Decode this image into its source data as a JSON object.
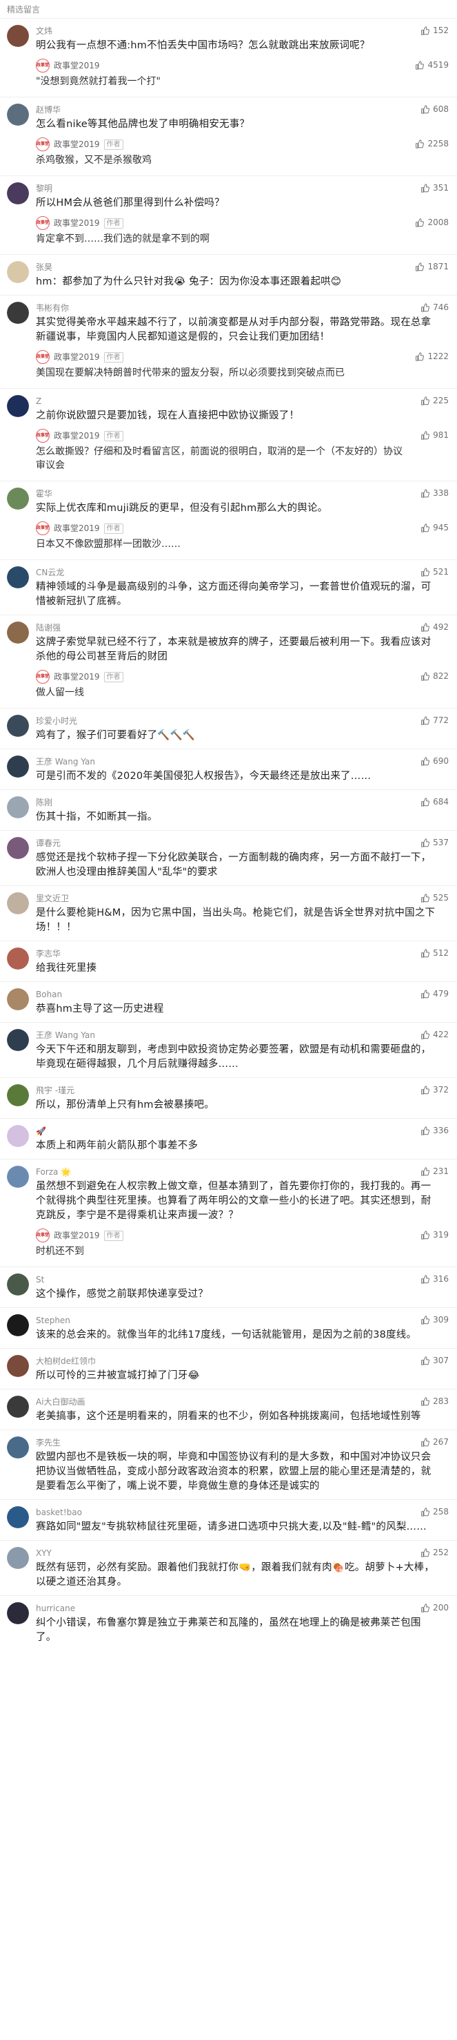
{
  "section_title": "精选留言",
  "colors": {
    "accent": "#e06060",
    "text": "#222222",
    "muted": "#8a8a8a"
  },
  "comments": [
    {
      "nick": "文炜",
      "likes": "152",
      "avatar_color": "#7a4a3a",
      "text": "明公我有一点想不通:hm不怕丢失中国市场吗？怎么就敢跳出来放厥词呢？",
      "reply": {
        "author": "政事堂2019",
        "badge": "",
        "likes": "4519",
        "text": "\"没想到竟然就打着我一个打\""
      }
    },
    {
      "nick": "赵博华",
      "likes": "608",
      "avatar_color": "#5c6e7e",
      "text": "怎么看nike等其他品牌也发了申明确相安无事？",
      "reply": {
        "author": "政事堂2019",
        "badge": "作者",
        "likes": "2258",
        "text": "杀鸡敬猴，又不是杀猴敬鸡"
      }
    },
    {
      "nick": "黎明",
      "likes": "351",
      "avatar_color": "#4a3a5e",
      "text": "所以HM会从爸爸们那里得到什么补偿吗？",
      "reply": {
        "author": "政事堂2019",
        "badge": "作者",
        "likes": "2008",
        "text": "肯定拿不到……我们选的就是拿不到的啊"
      }
    },
    {
      "nick": "张昊",
      "likes": "1871",
      "avatar_color": "#d8c8a8",
      "text": "hm：都参加了为什么只针对我😭 兔子：因为你没本事还跟着起哄😊",
      "reply": null
    },
    {
      "nick": "韦彬有你",
      "likes": "746",
      "avatar_color": "#3a3a3a",
      "text": "其实觉得美帝水平越来越不行了，以前演变都是从对手内部分裂，带路党带路。现在总拿新疆说事，毕竟国内人民都知道这是假的，只会让我们更加团结！",
      "reply": {
        "author": "政事堂2019",
        "badge": "作者",
        "likes": "1222",
        "text": "美国现在要解决特朗普时代带来的盟友分裂，所以必须要找到突破点而已"
      }
    },
    {
      "nick": "Z",
      "likes": "225",
      "avatar_color": "#1e2e5a",
      "text": "之前你说欧盟只是要加钱，现在人直接把中欧协议撕毁了！",
      "reply": {
        "author": "政事堂2019",
        "badge": "作者",
        "likes": "981",
        "text": "怎么敢撕毁？仔细和及时看留言区，前面说的很明白，取消的是一个（不友好的）协议审议会"
      }
    },
    {
      "nick": "霍华",
      "likes": "338",
      "avatar_color": "#6a8a5a",
      "text": "实际上优衣库和muji跳反的更早，但没有引起hm那么大的舆论。",
      "reply": {
        "author": "政事堂2019",
        "badge": "作者",
        "likes": "945",
        "text": "日本又不像欧盟那样一团散沙……"
      }
    },
    {
      "nick": "CN云龙",
      "likes": "521",
      "avatar_color": "#2a4a6a",
      "text": "精神领域的斗争是最高级别的斗争，这方面还得向美帝学习，一套普世价值观玩的溜，可惜被新冠扒了底裤。",
      "reply": null
    },
    {
      "nick": "陆谢强",
      "likes": "492",
      "avatar_color": "#8a6a4a",
      "text": "这牌子索觉早就已经不行了，本来就是被放弃的牌子，还要最后被利用一下。我看应该对杀他的母公司甚至背后的财团",
      "reply": {
        "author": "政事堂2019",
        "badge": "作者",
        "likes": "822",
        "text": "做人留一线"
      }
    },
    {
      "nick": "珍爱小时光",
      "likes": "772",
      "avatar_color": "#3a4a5a",
      "text": "鸡有了，猴子们可要看好了🔨🔨🔨",
      "reply": null
    },
    {
      "nick": "王彦 Wang Yan",
      "likes": "690",
      "avatar_color": "#2e3e4e",
      "text": "可是引而不发的《2020年美国侵犯人权报告》，今天最终还是放出来了……",
      "reply": null
    },
    {
      "nick": "陈刚",
      "likes": "684",
      "avatar_color": "#9aa6b2",
      "text": "伤其十指，不如断其一指。",
      "reply": null
    },
    {
      "nick": "谭春元",
      "likes": "537",
      "avatar_color": "#7a5a7a",
      "text": "感觉还是找个软柿子捏一下分化欧美联合，一方面制裁的确肉疼，另一方面不敲打一下，欧洲人也没理由推辞美国人\"乱华\"的要求",
      "reply": null
    },
    {
      "nick": "里文近卫",
      "likes": "525",
      "avatar_color": "#c0b0a0",
      "text": "是什么要枪毙H&M，因为它黑中国，当出头鸟。枪毙它们，就是告诉全世界对抗中国之下场！！！",
      "reply": null
    },
    {
      "nick": "李志华",
      "likes": "512",
      "avatar_color": "#b06050",
      "text": "给我往死里揍",
      "reply": null
    },
    {
      "nick": "Bohan",
      "likes": "479",
      "avatar_color": "#a88866",
      "text": "恭喜hm主导了这一历史进程",
      "reply": null
    },
    {
      "nick": "王彦 Wang Yan",
      "likes": "422",
      "avatar_color": "#2e3e4e",
      "text": "今天下午还和朋友聊到，考虑到中欧投资协定势必要签署，欧盟是有动机和需要砸盘的，毕竟现在砸得越狠，几个月后就赚得越多……",
      "reply": null
    },
    {
      "nick": "飛宇 -瑾元",
      "likes": "372",
      "avatar_color": "#5a7a3a",
      "text": "所以，那份清单上只有hm会被暴揍吧。",
      "reply": null
    },
    {
      "nick": "🚀",
      "likes": "336",
      "avatar_color": "#d4c0e0",
      "text": "本质上和两年前火箭队那个事差不多",
      "reply": null
    },
    {
      "nick": "Forza 🌟",
      "likes": "231",
      "avatar_color": "#6a8ab0",
      "text": "虽然想不到避免在人权宗教上做文章，但基本猜到了，首先要你打你的，我打我的。再一个就得挑个典型往死里揍。也算看了两年明公的文章一些小的长进了吧。其实还想到，耐克跳反，李宁是不是得乘机让来声援一波？？",
      "reply": {
        "author": "政事堂2019",
        "badge": "作者",
        "likes": "319",
        "text": "时机还不到"
      }
    },
    {
      "nick": "St",
      "likes": "316",
      "avatar_color": "#4a5a4a",
      "text": "这个操作，感觉之前联邦快递享受过？",
      "reply": null
    },
    {
      "nick": "Stephen",
      "likes": "309",
      "avatar_color": "#1a1a1a",
      "text": "该来的总会来的。就像当年的北纬17度线，一句话就能管用，是因为之前的38度线。",
      "reply": null
    },
    {
      "nick": "大柏树de红领巾",
      "likes": "307",
      "avatar_color": "#7a4a3a",
      "text": "所以可怜的三井被宣城打掉了门牙😂",
      "reply": null
    },
    {
      "nick": "Ai大白御动画",
      "likes": "283",
      "avatar_color": "#3a3a3a",
      "text": "老美搞事，这个还是明看来的，阴看来的也不少，例如各种挑拨离间，包括地域性别等",
      "reply": null
    },
    {
      "nick": "李先生",
      "likes": "267",
      "avatar_color": "#4a6a8a",
      "text": "欧盟内部也不是铁板一块的啊，毕竟和中国签协议有利的是大多数，和中国对冲协议只会把协议当做牺牲品，变成小部分政客政治资本的积累，欧盟上层的能心里还是清楚的，就是要看怎么平衡了，嘴上说不要，毕竟做生意的身体还是诚实的",
      "reply": null
    },
    {
      "nick": "basket!bao",
      "likes": "258",
      "avatar_color": "#2a5a8a",
      "text": "赛路如同\"盟友\"专挑软柿鼠往死里砸，请多进口选项中只挑大麦,以及\"鲑-鳕\"的风梨……",
      "reply": null
    },
    {
      "nick": "XYY",
      "likes": "252",
      "avatar_color": "#8a9aaa",
      "text": "既然有惩罚，必然有奖励。跟着他们我就打你🤜，跟着我们就有肉🍖吃。胡萝卜+大棒，以硬之道还治其身。",
      "reply": null
    },
    {
      "nick": "hurricane",
      "likes": "200",
      "avatar_color": "#2a2a3a",
      "text": "纠个小错误，布鲁塞尔算是独立于弗莱芒和瓦隆的，虽然在地理上的确是被弗莱芒包围了。",
      "reply": null
    }
  ]
}
